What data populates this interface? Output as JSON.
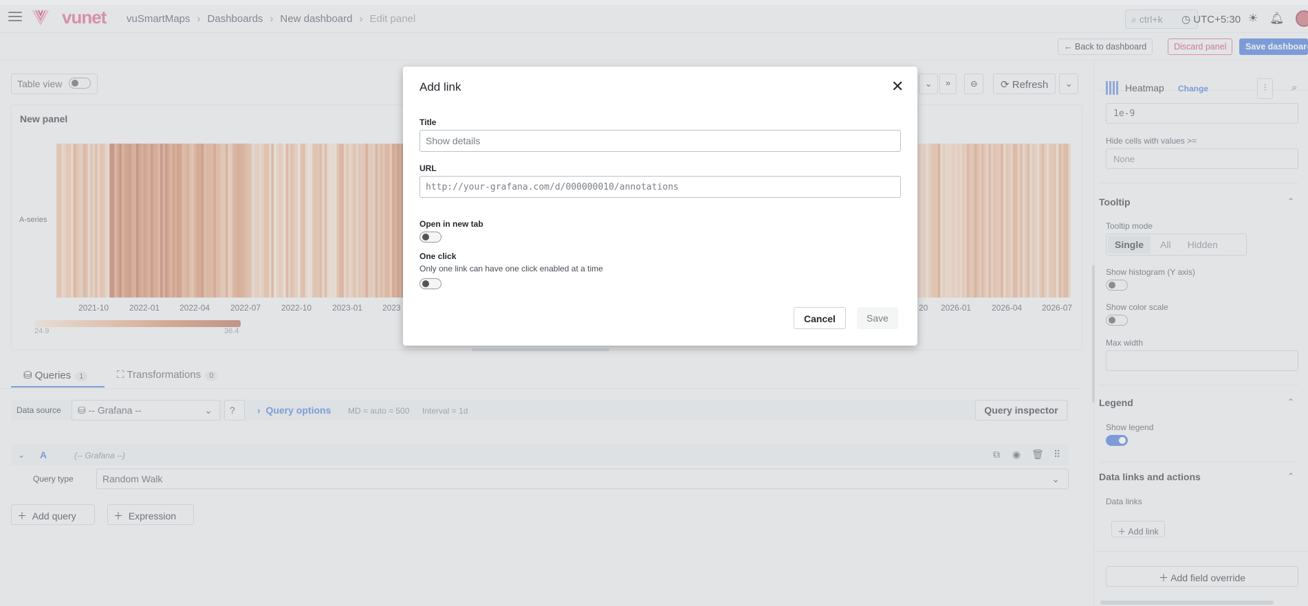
{
  "topbar": {
    "logo": "vunet",
    "breadcrumb": [
      "vuSmartMaps",
      "Dashboards",
      "New dashboard",
      "Edit panel"
    ],
    "search_placeholder": "ctrl+k",
    "timezone": "UTC+5:30"
  },
  "toolbar": {
    "back": "Back to dashboard",
    "discard": "Discard panel",
    "save": "Save dashboard"
  },
  "panel_controls": {
    "table_view": "Table view",
    "refresh": "Refresh"
  },
  "panel": {
    "title": "New panel",
    "series_label": "A-series",
    "x_ticks_left": [
      "2021-10",
      "2022-01",
      "2022-04",
      "2022-07",
      "2022-10",
      "2023-01",
      "2023"
    ],
    "x_ticks_right": [
      "20",
      "2026-01",
      "2026-04",
      "2026-07"
    ],
    "scale_min": "24.9",
    "scale_max": "36.4"
  },
  "chart_data": {
    "type": "heatmap",
    "series": [
      {
        "name": "A-series"
      }
    ],
    "color_min": 24.9,
    "color_max": 36.4,
    "colors": [
      "#fbe7d9",
      "#f0b995",
      "#d8875e",
      "#b96449"
    ]
  },
  "query_tabs": {
    "queries_label": "Queries",
    "queries_count": "1",
    "transformations_label": "Transformations",
    "transformations_count": "0"
  },
  "datasource": {
    "label": "Data source",
    "value": "-- Grafana --",
    "query_options": "Query options",
    "md": "MD = auto = 500",
    "interval": "Interval = 1d",
    "inspector": "Query inspector"
  },
  "query": {
    "ref": "A",
    "ds_hint": "(-- Grafana --)",
    "type_label": "Query type",
    "type_value": "Random Walk",
    "add_query": "Add query",
    "expression": "Expression"
  },
  "right_panel": {
    "viz_name": "Heatmap",
    "change": "Change",
    "min_value": "1e-9",
    "hide_cells_label": "Hide cells with values >=",
    "hide_cells_placeholder": "None",
    "tooltip_section": "Tooltip",
    "tooltip_mode_label": "Tooltip mode",
    "tooltip_modes": [
      "Single",
      "All",
      "Hidden"
    ],
    "show_histogram": "Show histogram (Y axis)",
    "show_color_scale": "Show color scale",
    "max_width": "Max width",
    "legend_section": "Legend",
    "show_legend": "Show legend",
    "links_section": "Data links and actions",
    "data_links": "Data links",
    "add_link": "Add link",
    "add_field_override": "Add field override"
  },
  "modal": {
    "title": "Add link",
    "title_label": "Title",
    "title_placeholder": "Show details",
    "url_label": "URL",
    "url_placeholder": "http://your-grafana.com/d/000000010/annotations",
    "new_tab_label": "Open in new tab",
    "one_click_label": "One click",
    "one_click_desc": "Only one link can have one click enabled at a time",
    "cancel": "Cancel",
    "save": "Save"
  },
  "colors": {
    "accent": "#3d71d9",
    "brand": "#e0598b",
    "heat_dark": "#b96449",
    "heat_light": "#fbe7d9"
  }
}
